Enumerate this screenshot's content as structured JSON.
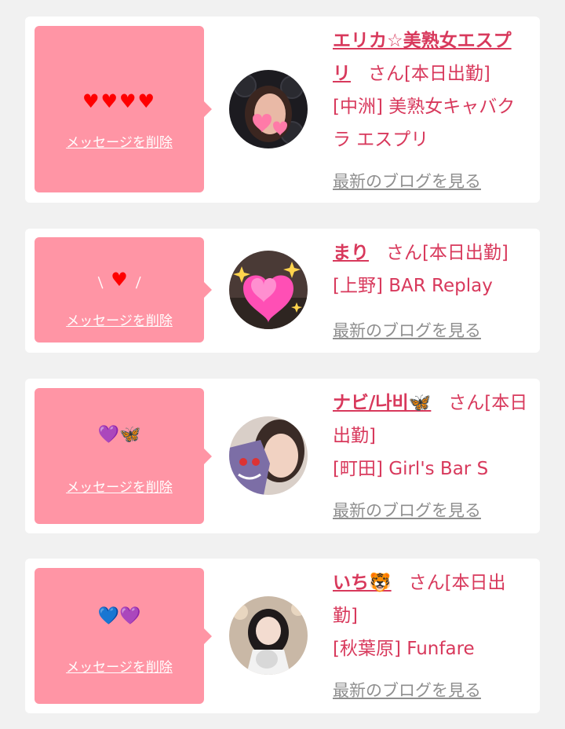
{
  "items": [
    {
      "icons": "♥♥♥♥",
      "icon_color": "#ff0000",
      "delete_label": "メッセージを削除",
      "name": "エリカ☆美熟女エスプリ",
      "suffix": "さん[本日出勤]",
      "shop": "[中洲] 美熟女キャバクラ エスプリ",
      "blog_label": "最新のブログを見る"
    },
    {
      "icons": "♥",
      "icon_color": "#ff0000",
      "delete_label": "メッセージを削除",
      "name": "まり",
      "suffix": "さん[本日出勤]",
      "shop": "[上野] BAR Replay",
      "blog_label": "最新のブログを見る"
    },
    {
      "icons": "💜🦋",
      "delete_label": "メッセージを削除",
      "name": "ナビ/나비🦋",
      "suffix": "さん[本日出勤]",
      "shop": "[町田] Girl's Bar S",
      "blog_label": "最新のブログを見る"
    },
    {
      "icons": "💙💜",
      "delete_label": "メッセージを削除",
      "name": "いち🐯",
      "suffix": "さん[本日出勤]",
      "shop": "[秋葉原] Funfare",
      "blog_label": "最新のブログを見る"
    }
  ],
  "colors": {
    "page_bg": "#f1f1f1",
    "card_bg": "#ffffff",
    "bubble_bg": "#ff95a5",
    "accent": "#d8395c",
    "link_gray": "#8f8f8f"
  }
}
